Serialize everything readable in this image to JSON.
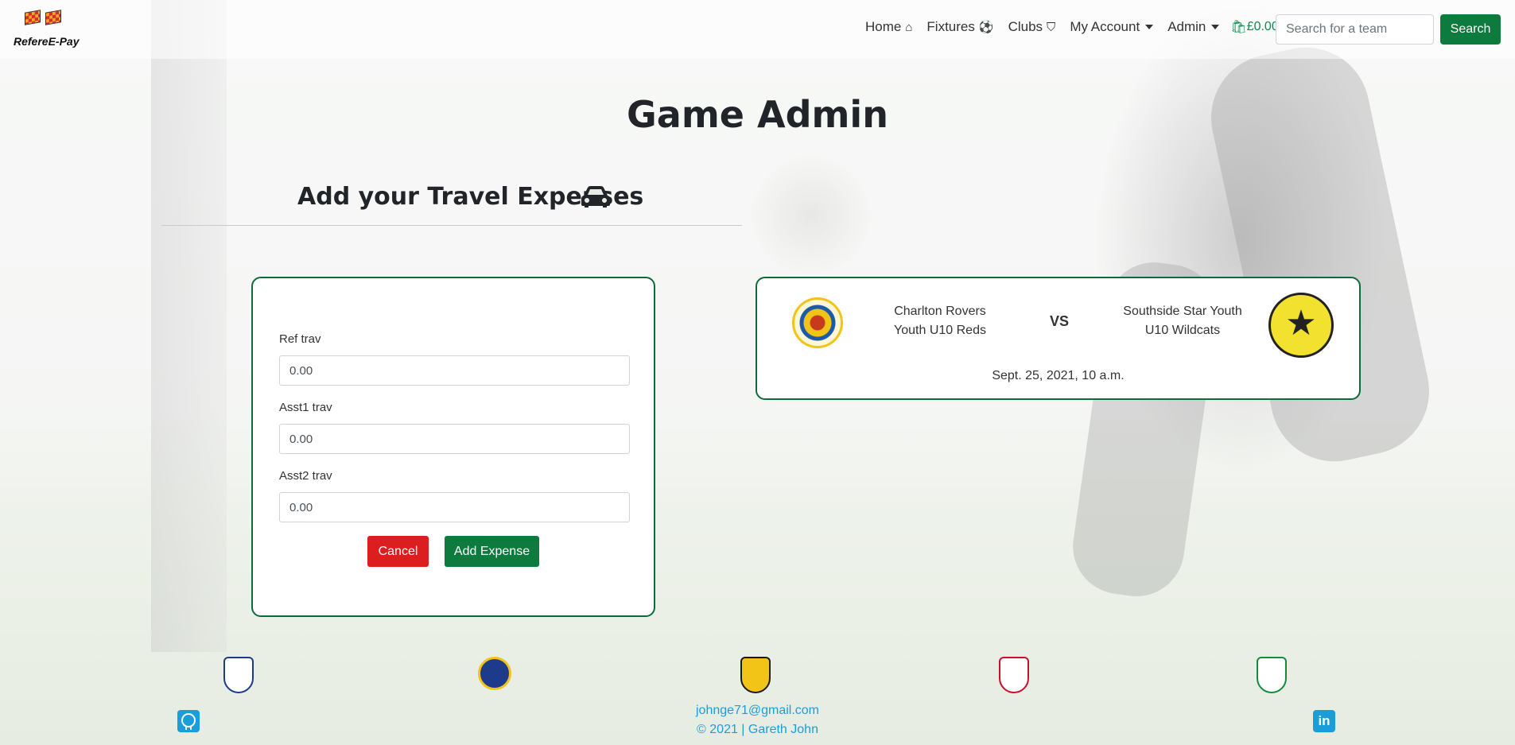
{
  "brand": {
    "name": "RefereE-Pay"
  },
  "nav": {
    "home": "Home",
    "fixtures": "Fixtures",
    "clubs": "Clubs",
    "my_account": "My Account",
    "admin": "Admin",
    "basket_total": "£0.00",
    "search_placeholder": "Search for a team",
    "search_button": "Search"
  },
  "page": {
    "title": "Game Admin",
    "section_title": "Add your Travel Expenses"
  },
  "form": {
    "fields": [
      {
        "label": "Ref trav",
        "value": "0.00"
      },
      {
        "label": "Asst1 trav",
        "value": "0.00"
      },
      {
        "label": "Asst2 trav",
        "value": "0.00"
      }
    ],
    "cancel_label": "Cancel",
    "submit_label": "Add Expense"
  },
  "fixture": {
    "home_team_line1": "Charlton Rovers",
    "home_team_line2": "Youth U10 Reds",
    "vs": "VS",
    "away_team_line1": "Southside Star Youth",
    "away_team_line2": "U10 Wildcats",
    "date": "Sept. 25, 2021, 10 a.m."
  },
  "footer": {
    "email": "johnge71@gmail.com",
    "copyright": "2021 | Gareth John"
  },
  "colors": {
    "primary_green": "#0d7a3e",
    "danger_red": "#dc1e1e",
    "link_blue": "#1a9ed9"
  }
}
